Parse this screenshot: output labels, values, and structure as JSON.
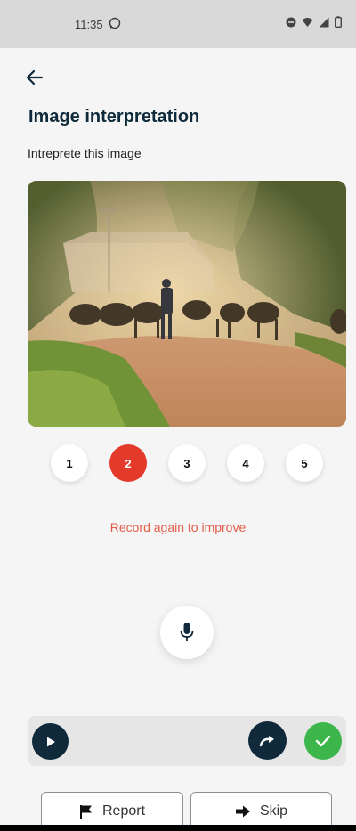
{
  "status_bar": {
    "time": "11:35",
    "icons": [
      "whatsapp-icon",
      "dnd-icon",
      "wifi-icon",
      "signal-icon",
      "battery-icon"
    ]
  },
  "header": {
    "back_icon": "arrow-left-icon"
  },
  "task": {
    "title": "Image interpretation",
    "instruction": "Intreprete this image"
  },
  "pager": {
    "pages": [
      "1",
      "2",
      "3",
      "4",
      "5"
    ],
    "active_index": 1
  },
  "recording": {
    "hint": "Record again to improve",
    "mic_icon": "microphone-icon"
  },
  "player": {
    "play_icon": "play-icon",
    "redo_icon": "redo-icon",
    "confirm_icon": "check-icon"
  },
  "actions": {
    "report_label": "Report",
    "report_icon": "flag-icon",
    "skip_label": "Skip",
    "skip_icon": "arrow-right-icon"
  },
  "colors": {
    "primary_dark": "#10293b",
    "accent_red": "#e43a2b",
    "hint_red": "#e35d4a",
    "success_green": "#3cb54a"
  }
}
